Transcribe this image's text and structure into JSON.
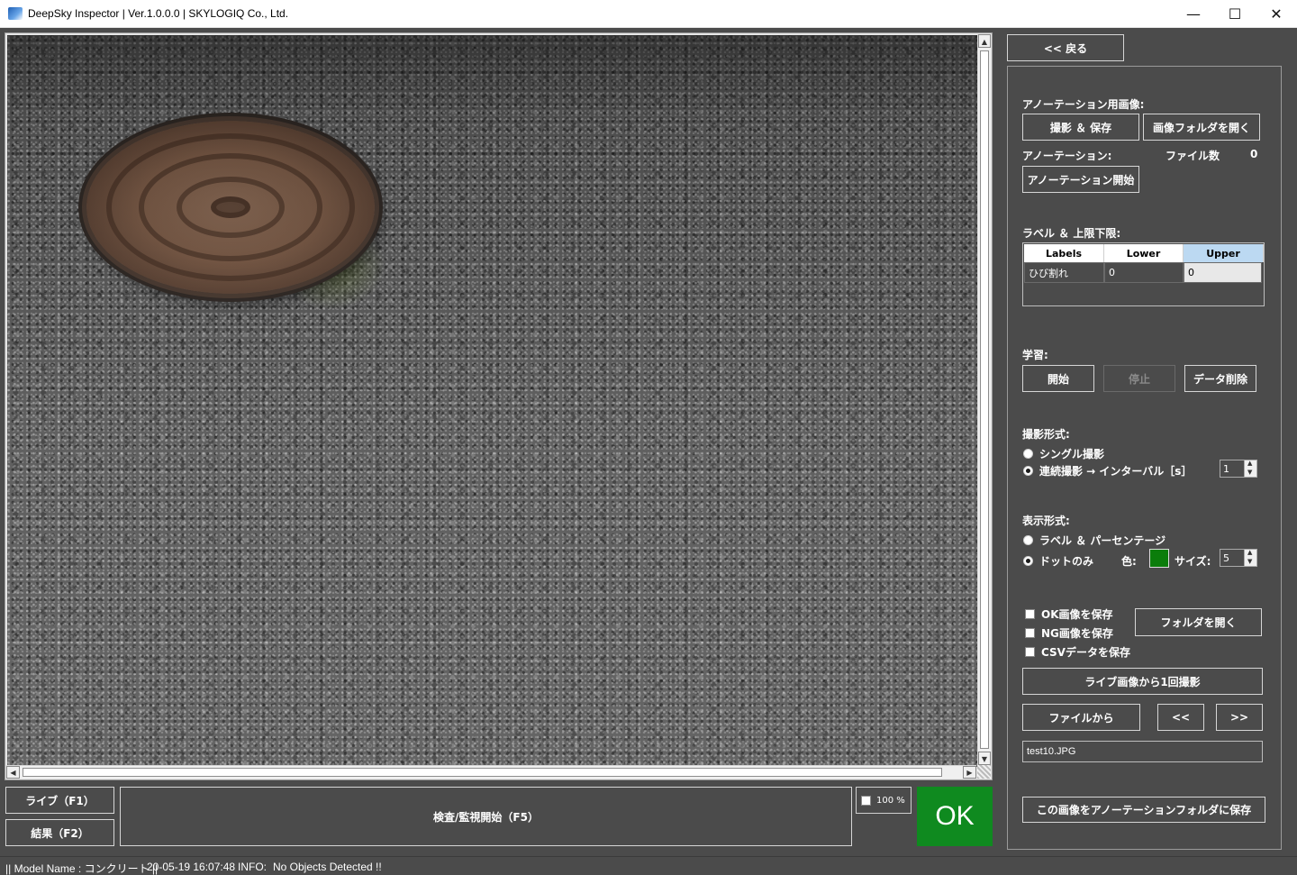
{
  "window": {
    "title": "DeepSky Inspector | Ver.1.0.0.0 | SKYLOGIQ Co., Ltd.",
    "minimize": "—",
    "maximize": "☐",
    "close": "✕"
  },
  "viewport": {
    "scroll_up": "▲",
    "scroll_down": "▼",
    "scroll_left": "◀",
    "scroll_right": "▶"
  },
  "bottom": {
    "live_button": "ライブ（F1）",
    "result_button": "結果（F2）",
    "inspect_button": "検査/監視開始（F5）",
    "zoom_label": "100 %",
    "judgement": "OK",
    "judgement_color": "#0f8a1f"
  },
  "status": {
    "model": "|| Model Name : コンクリート ||",
    "timestamp": "20-05-19 16:07:48",
    "info_label": "INFO:",
    "info_message": "No Objects Detected !!"
  },
  "panel": {
    "back_button": "<< 戻る",
    "annotation_image_label": "アノーテーション用画像:",
    "capture_save_button": "撮影 ＆ 保存",
    "open_image_folder_button": "画像フォルダを開く",
    "annotation_label": "アノーテーション:",
    "file_count_label": "ファイル数",
    "file_count_value": "0",
    "start_annotation_button": "アノーテーション開始",
    "label_limits_label": "ラベル ＆ 上限下限:",
    "grid": {
      "headers": [
        "Labels",
        "Lower",
        "Upper"
      ],
      "rows": [
        [
          "ひび割れ",
          "0",
          "0"
        ]
      ]
    },
    "learning_label": "学習:",
    "learn_start_button": "開始",
    "learn_stop_button": "停止",
    "delete_data_button": "データ削除",
    "capture_mode_label": "撮影形式:",
    "single_capture_option": "シングル撮影",
    "continuous_capture_option": "連続撮影 → インターバル［s］",
    "interval_value": "1",
    "display_mode_label": "表示形式:",
    "label_percentage_option": "ラベル ＆ パーセンテージ",
    "dot_only_option": "ドットのみ",
    "color_label": "色:",
    "dot_color": "#0b7d0b",
    "size_label": "サイズ:",
    "size_value": "5",
    "save_ok_option": "OK画像を保存",
    "save_ng_option": "NG画像を保存",
    "save_csv_option": "CSVデータを保存",
    "open_folder_button": "フォルダを開く",
    "capture_once_button": "ライブ画像から1回撮影",
    "from_file_button": "ファイルから",
    "prev_button": "<<",
    "next_button": ">>",
    "filename": "test10.JPG",
    "save_to_annotation_button": "この画像をアノーテーションフォルダに保存"
  }
}
